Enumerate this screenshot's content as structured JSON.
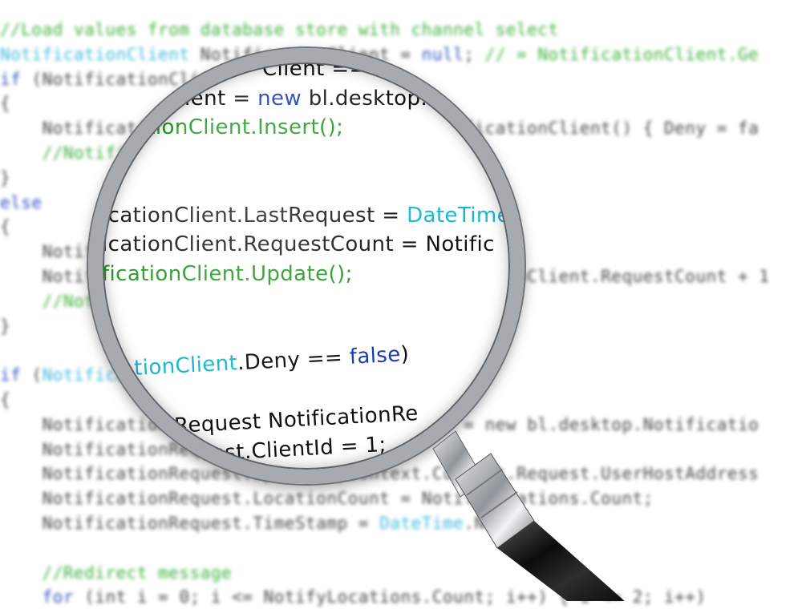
{
  "colors": {
    "comment": "#2aa82a",
    "type": "#2bb3d6",
    "keyword": "#1a3fb8",
    "text": "#333333",
    "lens_comment": "#1f9a1f",
    "lens_type": "#18b7cf",
    "lens_keyword": "#163db3",
    "lens_text": "#111111"
  },
  "background_code": [
    {
      "tokens": [
        {
          "t": "//Load values from database store with channel select",
          "c": "comment"
        }
      ]
    },
    {
      "tokens": [
        {
          "t": "NotificationClient ",
          "c": "type"
        },
        {
          "t": "NotificationClient = ",
          "c": "text"
        },
        {
          "t": "null",
          "c": "keyword"
        },
        {
          "t": "; ",
          "c": "text"
        },
        {
          "t": "// = NotificationClient.Ge",
          "c": "comment"
        }
      ]
    },
    {
      "tokens": [
        {
          "t": "if",
          "c": "keyword"
        },
        {
          "t": " (NotificationClient == null)",
          "c": "text"
        }
      ]
    },
    {
      "tokens": [
        {
          "t": "{",
          "c": "text"
        }
      ]
    },
    {
      "tokens": [
        {
          "t": "    NotificationClient = new bl.desktop.NotificationClient() { Deny = fa",
          "c": "text"
        }
      ]
    },
    {
      "tokens": [
        {
          "t": "    //NotificationClient.Insert();",
          "c": "comment"
        }
      ]
    },
    {
      "tokens": [
        {
          "t": "}",
          "c": "text"
        }
      ]
    },
    {
      "tokens": [
        {
          "t": "else",
          "c": "keyword"
        }
      ]
    },
    {
      "tokens": [
        {
          "t": "{",
          "c": "text"
        }
      ]
    },
    {
      "tokens": [
        {
          "t": "    NotificationClient.LastRequest = DateTime.Now;",
          "c": "text"
        }
      ]
    },
    {
      "tokens": [
        {
          "t": "    NotificationClient.RequestCount = NotificationClient.RequestCount + 1",
          "c": "text"
        }
      ]
    },
    {
      "tokens": [
        {
          "t": "    //NotificationClient.Update();",
          "c": "comment"
        }
      ]
    },
    {
      "tokens": [
        {
          "t": "}",
          "c": "text"
        }
      ]
    },
    {
      "tokens": [
        {
          "t": "",
          "c": "text"
        }
      ]
    },
    {
      "tokens": [
        {
          "t": "if",
          "c": "keyword"
        },
        {
          "t": " (",
          "c": "text"
        },
        {
          "t": "NotificationClient",
          "c": "type"
        },
        {
          "t": ".Deny == false)",
          "c": "text"
        }
      ]
    },
    {
      "tokens": [
        {
          "t": "{",
          "c": "text"
        }
      ]
    },
    {
      "tokens": [
        {
          "t": "    NotificationRequest NotificationRequest = new bl.desktop.Notificatio",
          "c": "text"
        }
      ]
    },
    {
      "tokens": [
        {
          "t": "    NotificationRequest.ClientId = 1;",
          "c": "text"
        }
      ]
    },
    {
      "tokens": [
        {
          "t": "    NotificationRequest.Ip = HttpContext.Current.Request.UserHostAddress",
          "c": "text"
        }
      ]
    },
    {
      "tokens": [
        {
          "t": "    NotificationRequest.LocationCount = NotifyLocations.Count;",
          "c": "text"
        }
      ]
    },
    {
      "tokens": [
        {
          "t": "    NotificationRequest.TimeStamp = ",
          "c": "text"
        },
        {
          "t": "DateTime",
          "c": "type"
        },
        {
          "t": ".Now;",
          "c": "text"
        }
      ]
    },
    {
      "tokens": [
        {
          "t": "",
          "c": "text"
        }
      ]
    },
    {
      "tokens": [
        {
          "t": "    //Redirect message",
          "c": "comment"
        }
      ]
    },
    {
      "tokens": [
        {
          "t": "    ",
          "c": "text"
        },
        {
          "t": "for",
          "c": "keyword"
        },
        {
          "t": " (int i = 0; i <= NotifyLocations.Count; i++) { i <= 2; i++)",
          "c": "text"
        }
      ]
    }
  ],
  "lens_code": [
    {
      "tokens": [
        {
          "t": "Client == null)",
          "c": "text"
        }
      ]
    },
    {
      "tokens": [
        {
          "t": "nClient = ",
          "c": "text"
        },
        {
          "t": "new",
          "c": "keyword"
        },
        {
          "t": " bl.desktop.",
          "c": "text"
        }
      ]
    },
    {
      "tokens": [
        {
          "t": "ationClient.Insert();",
          "c": "comment"
        }
      ]
    },
    {
      "tokens": [
        {
          "t": "",
          "c": "text"
        }
      ]
    },
    {
      "tokens": [
        {
          "t": "",
          "c": "text"
        }
      ]
    },
    {
      "tokens": [
        {
          "t": "icationClient.LastRequest = ",
          "c": "text"
        },
        {
          "t": "DateTime",
          "c": "type"
        }
      ]
    },
    {
      "tokens": [
        {
          "t": "icationClient.RequestCount = Notific",
          "c": "text"
        }
      ]
    },
    {
      "tokens": [
        {
          "t": "ficationClient.Update();",
          "c": "comment"
        }
      ]
    },
    {
      "tokens": [
        {
          "t": "",
          "c": "text"
        }
      ]
    },
    {
      "tokens": [
        {
          "t": "",
          "c": "text"
        }
      ]
    },
    {
      "tokens": [
        {
          "t": "tionClient",
          "c": "type"
        },
        {
          "t": ".Deny == ",
          "c": "text"
        },
        {
          "t": "false",
          "c": "keyword"
        },
        {
          "t": ")",
          "c": "text"
        }
      ]
    },
    {
      "tokens": [
        {
          "t": "",
          "c": "text"
        }
      ]
    },
    {
      "tokens": [
        {
          "t": "Request NotificationRe",
          "c": "text"
        }
      ]
    },
    {
      "tokens": [
        {
          "t": "uest.ClientId = 1;",
          "c": "text"
        }
      ]
    }
  ]
}
